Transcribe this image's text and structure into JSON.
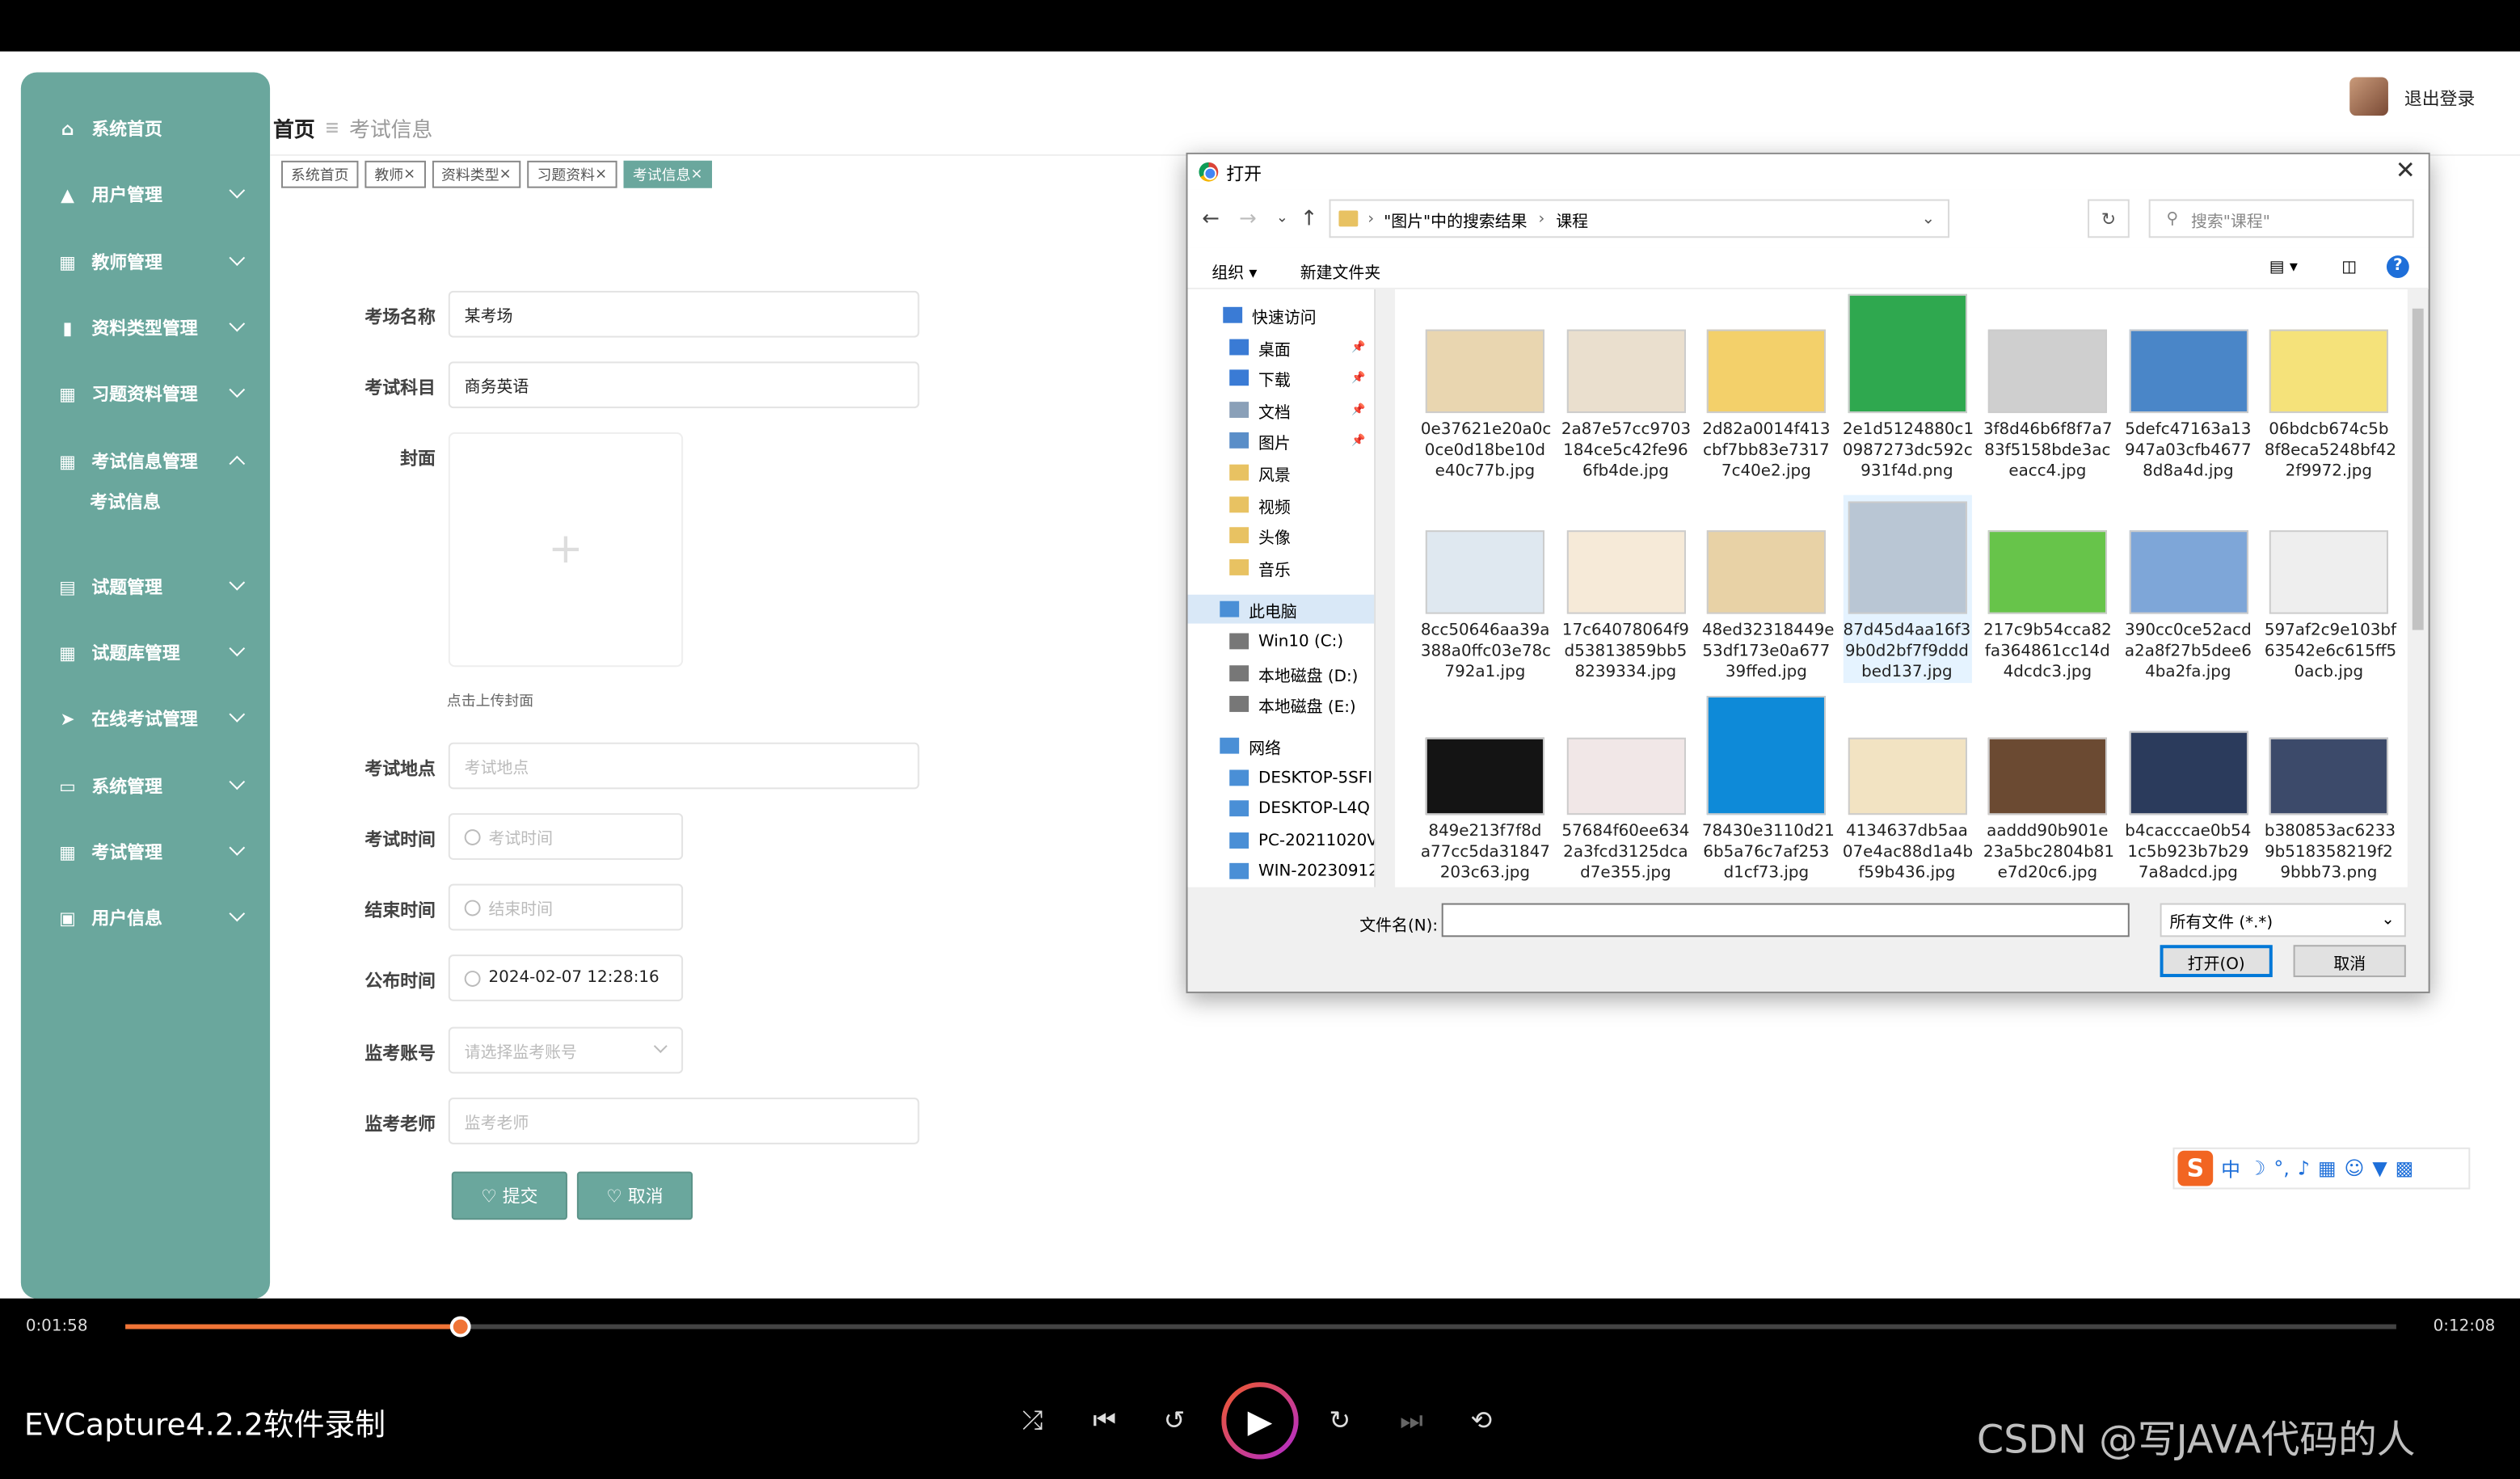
{
  "sidebar": {
    "items": [
      {
        "label": "系统首页",
        "icon": "home-icon"
      },
      {
        "label": "用户管理",
        "icon": "user-icon"
      },
      {
        "label": "教师管理",
        "icon": "grid-icon"
      },
      {
        "label": "资料类型管理",
        "icon": "book-icon"
      },
      {
        "label": "习题资料管理",
        "icon": "grid-icon"
      },
      {
        "label": "考试信息管理",
        "icon": "grid-icon"
      },
      {
        "label": "试题管理",
        "icon": "clipboard-icon"
      },
      {
        "label": "试题库管理",
        "icon": "grid-icon"
      },
      {
        "label": "在线考试管理",
        "icon": "send-icon"
      },
      {
        "label": "系统管理",
        "icon": "monitor-icon"
      },
      {
        "label": "考试管理",
        "icon": "grid-icon"
      },
      {
        "label": "用户信息",
        "icon": "card-icon"
      }
    ],
    "subitem": "考试信息"
  },
  "breadcrumb": {
    "home": "首页",
    "current": "考试信息"
  },
  "tabs": [
    "系统首页",
    "教师",
    "资料类型",
    "习题资料",
    "考试信息"
  ],
  "header": {
    "logout": "退出登录"
  },
  "form": {
    "venue_label": "考场名称",
    "venue_value": "某考场",
    "subject_label": "考试科目",
    "subject_value": "商务英语",
    "cover_label": "封面",
    "cover_hint": "点击上传封面",
    "location_label": "考试地点",
    "location_placeholder": "考试地点",
    "start_label": "考试时间",
    "start_placeholder": "考试时间",
    "end_label": "结束时间",
    "end_placeholder": "结束时间",
    "publish_label": "公布时间",
    "publish_value": "2024-02-07 12:28:16",
    "proctor_account_label": "监考账号",
    "proctor_account_placeholder": "请选择监考账号",
    "proctor_teacher_label": "监考老师",
    "proctor_teacher_placeholder": "监考老师",
    "submit": "提交",
    "cancel": "取消"
  },
  "dialog": {
    "title": "打开",
    "path": [
      "\"图片\"中的搜索结果",
      "课程"
    ],
    "search_placeholder": "搜索\"课程\"",
    "organize": "组织 ▾",
    "new_folder": "新建文件夹",
    "tree": [
      {
        "label": "快速访问",
        "icon": "star-icon"
      },
      {
        "label": "桌面",
        "icon": "desktop-icon"
      },
      {
        "label": "下载",
        "icon": "download-icon"
      },
      {
        "label": "文档",
        "icon": "document-icon"
      },
      {
        "label": "图片",
        "icon": "picture-icon"
      },
      {
        "label": "风景",
        "icon": "folder-icon"
      },
      {
        "label": "视频",
        "icon": "folder-icon"
      },
      {
        "label": "头像",
        "icon": "folder-icon"
      },
      {
        "label": "音乐",
        "icon": "folder-icon"
      },
      {
        "label": "此电脑",
        "icon": "computer-icon"
      },
      {
        "label": "Win10 (C:)",
        "icon": "drive-icon"
      },
      {
        "label": "本地磁盘 (D:)",
        "icon": "drive-icon"
      },
      {
        "label": "本地磁盘 (E:)",
        "icon": "drive-icon"
      },
      {
        "label": "网络",
        "icon": "network-icon"
      },
      {
        "label": "DESKTOP-5SFI",
        "icon": "computer-icon"
      },
      {
        "label": "DESKTOP-L4Q",
        "icon": "computer-icon"
      },
      {
        "label": "PC-20211020V",
        "icon": "computer-icon"
      },
      {
        "label": "WIN-20230912",
        "icon": "computer-icon"
      }
    ],
    "files": [
      {
        "l1": "0e37621e20a0c",
        "l2": "0ce0d18be10d",
        "l3": "e40c77b.jpg",
        "color": "#e9d6b0"
      },
      {
        "l1": "2a87e57cc9703",
        "l2": "184ce5c42fe96",
        "l3": "6fb4de.jpg",
        "color": "#eadfce"
      },
      {
        "l1": "2d82a0014f413",
        "l2": "cbf7bb83e7317",
        "l3": "7c40e2.jpg",
        "color": "#f3d06a"
      },
      {
        "l1": "2e1d5124880c1",
        "l2": "0987273dc592c",
        "l3": "931f4d.png",
        "color": "#2fa84f"
      },
      {
        "l1": "3f8d46b6f8f7a7",
        "l2": "83f5158bde3ac",
        "l3": "eacc4.jpg",
        "color": "#cfcfcf"
      },
      {
        "l1": "5defc47163a13",
        "l2": "947a03cfb4677",
        "l3": "8d8a4d.jpg",
        "color": "#4a86c8"
      },
      {
        "l1": "06bdcb674c5b",
        "l2": "8f8eca5248bf42",
        "l3": "2f9972.jpg",
        "color": "#f5e27a"
      },
      {
        "l1": "8cc50646aa39a",
        "l2": "388a0ffc03e78c",
        "l3": "792a1.jpg",
        "color": "#dfe8f0"
      },
      {
        "l1": "17c64078064f9",
        "l2": "d53813859bb5",
        "l3": "8239334.jpg",
        "color": "#f6ead8"
      },
      {
        "l1": "48ed32318449e",
        "l2": "53df173e0a677",
        "l3": "39ffed.jpg",
        "color": "#e8d2a6"
      },
      {
        "l1": "87d45d4aa16f3",
        "l2": "9b0d2bf7f9ddd",
        "l3": "bed137.jpg",
        "color": "#b9c6d4"
      },
      {
        "l1": "217c9b54cca82",
        "l2": "fa364861cc14d",
        "l3": "4dcdc3.jpg",
        "color": "#67c44a"
      },
      {
        "l1": "390cc0ce52acd",
        "l2": "a2a8f27b5dee6",
        "l3": "4ba2fa.jpg",
        "color": "#7ea6d8"
      },
      {
        "l1": "597af2c9e103bf",
        "l2": "63542e6c615ff5",
        "l3": "0acb.jpg",
        "color": "#eeeeee"
      },
      {
        "l1": "849e213f7f8d",
        "l2": "a77cc5da31847",
        "l3": "203c63.jpg",
        "color": "#141414"
      },
      {
        "l1": "57684f60ee634",
        "l2": "2a3fcd3125dca",
        "l3": "d7e355.jpg",
        "color": "#f1e7e7"
      },
      {
        "l1": "78430e3110d21",
        "l2": "6b5a76c7af253",
        "l3": "d1cf73.jpg",
        "color": "#0e8ad8"
      },
      {
        "l1": "4134637db5aa",
        "l2": "07e4ac88d1a4b",
        "l3": "f59b436.jpg",
        "color": "#f2e3c2"
      },
      {
        "l1": "aaddd90b901e",
        "l2": "23a5bc2804b81",
        "l3": "e7d20c6.jpg",
        "color": "#6b4a32"
      },
      {
        "l1": "b4cacccae0b54",
        "l2": "1c5b923b7b29",
        "l3": "7a8adcd.jpg",
        "color": "#2b3b5c"
      },
      {
        "l1": "b380853ac6233",
        "l2": "9b518358219f2",
        "l3": "9bbb73.png",
        "color": "#3c4a6a"
      }
    ],
    "filename_label": "文件名(N):",
    "filetype": "所有文件 (*.*)",
    "open": "打开(O)",
    "cancel": "取消"
  },
  "ime": {
    "label": "中"
  },
  "player": {
    "elapsed": "0:01:58",
    "total": "0:12:08",
    "progress": 0.147,
    "brand": "EVCapture4.2.2软件录制",
    "watermark": "CSDN @写JAVA代码的人"
  }
}
